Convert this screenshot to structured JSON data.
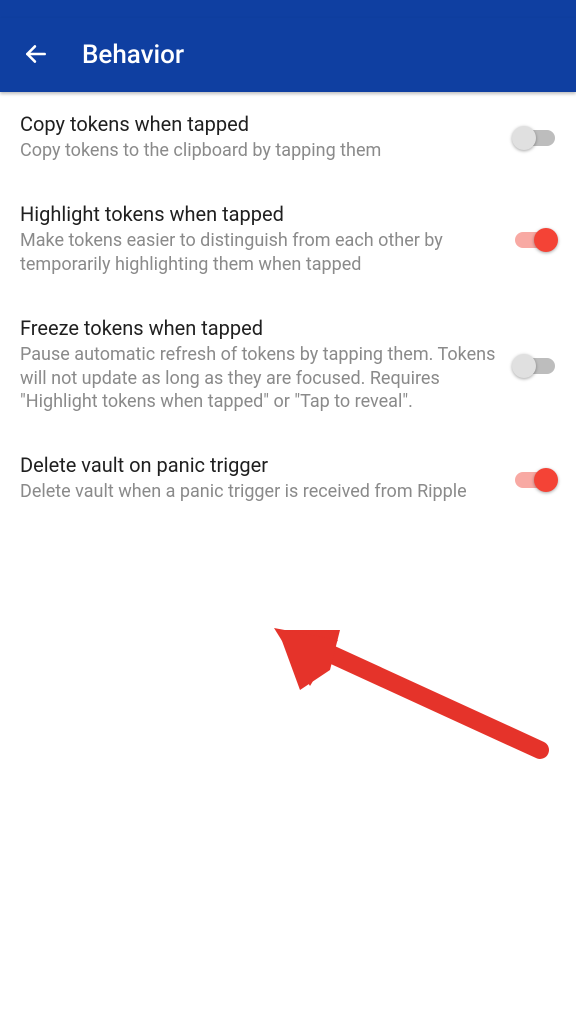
{
  "header": {
    "title": "Behavior"
  },
  "settings": [
    {
      "title": "Copy tokens when tapped",
      "description": "Copy tokens to the clipboard by tapping them",
      "enabled": false
    },
    {
      "title": "Highlight tokens when tapped",
      "description": "Make tokens easier to distinguish from each other by temporarily highlighting them when tapped",
      "enabled": true
    },
    {
      "title": "Freeze tokens when tapped",
      "description": "Pause automatic refresh of tokens by tapping them. Tokens will not update as long as they are focused. Requires \"Highlight tokens when tapped\" or \"Tap to reveal\".",
      "enabled": false
    },
    {
      "title": "Delete vault on panic trigger",
      "description": "Delete vault when a panic trigger is received from Ripple",
      "enabled": true
    }
  ],
  "colors": {
    "primary": "#0f3fa1",
    "accent": "#f44336"
  }
}
